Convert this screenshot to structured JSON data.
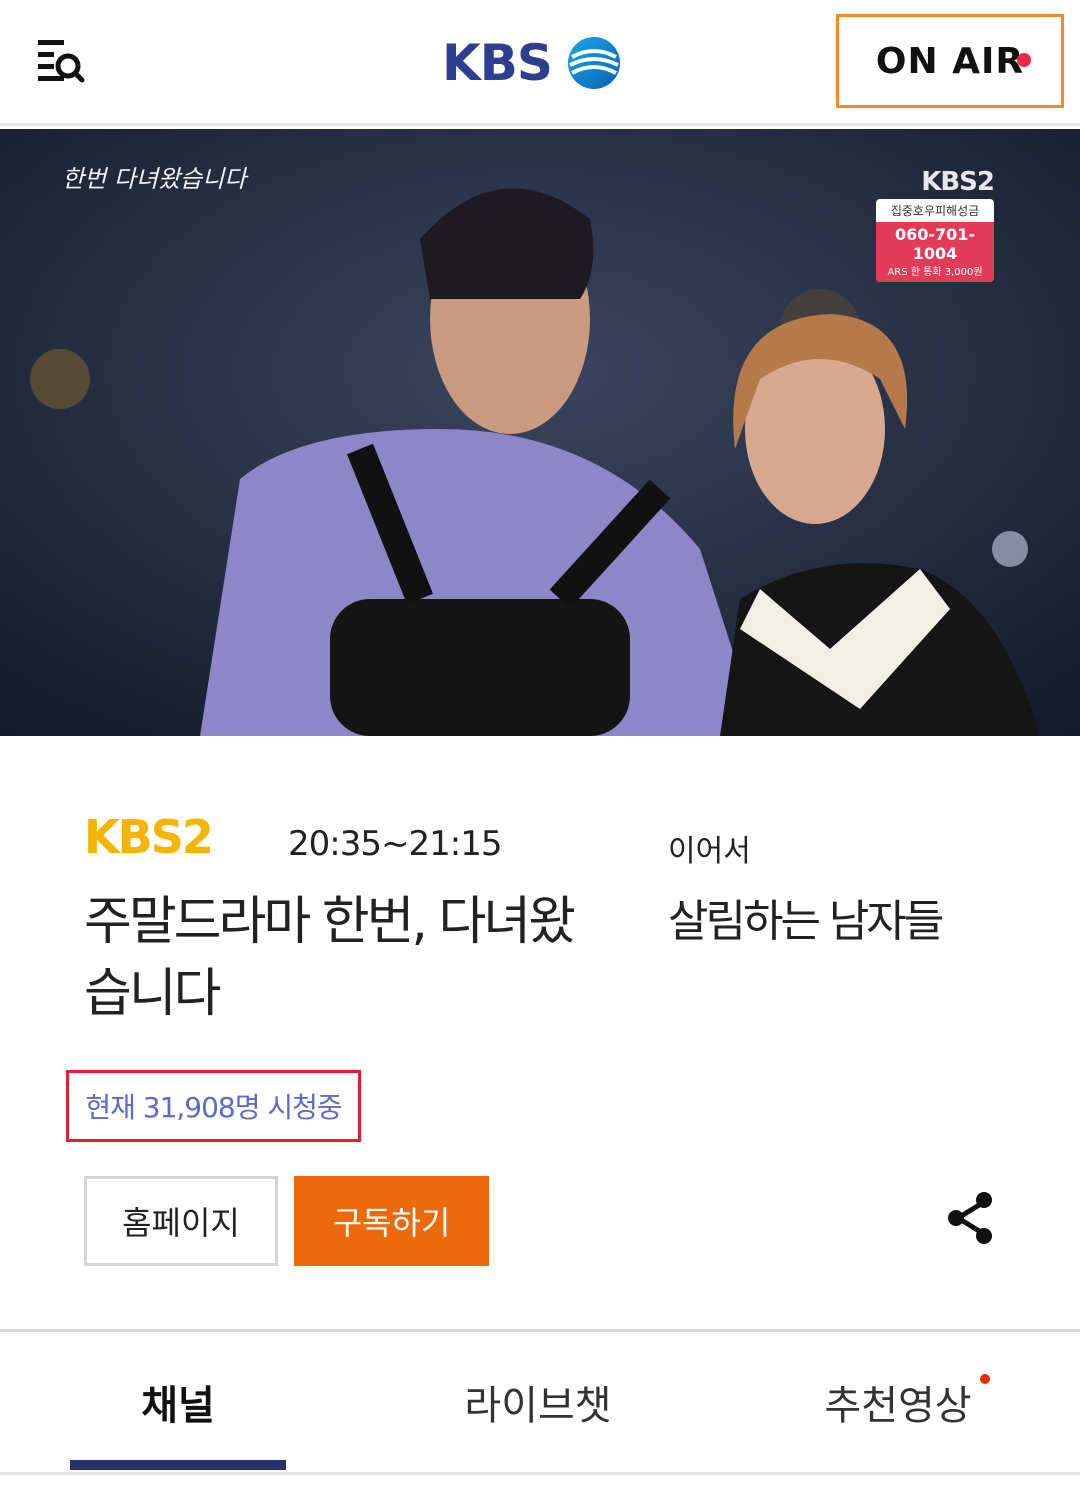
{
  "header": {
    "logo_text": "KBS",
    "onair_label": "ON AIR"
  },
  "player": {
    "overlay_title": "한번 다녀왔습니다",
    "channel_badge": {
      "logo": "KBS2",
      "campaign": "집중호우피해성금",
      "phone": "060-701-1004",
      "note": "ARS 한 통화 3,000원"
    }
  },
  "program": {
    "channel_logo": "KBS2",
    "time": "20:35~21:15",
    "title_line1": "주말드라마 한번, 다녀왔",
    "title_line2": "습니다",
    "next_label": "이어서",
    "next_title": "살림하는 남자들",
    "viewers": "현재 31,908명 시청중",
    "homepage_button": "홈페이지",
    "subscribe_button": "구독하기"
  },
  "tabs": [
    {
      "label": "채널",
      "active": true
    },
    {
      "label": "라이브챗",
      "active": false
    },
    {
      "label": "추천영상",
      "active": false,
      "has_badge": true
    }
  ],
  "colors": {
    "brand_blue": "#2e3f8f",
    "onair_border": "#f08a24",
    "live_dot": "#f02848",
    "kbs2_yellow": "#f5b400",
    "viewer_text": "#5a6bc8",
    "viewer_border": "#e3202f",
    "subscribe_bg": "#ec6a0a",
    "tab_underline": "#26316e"
  }
}
